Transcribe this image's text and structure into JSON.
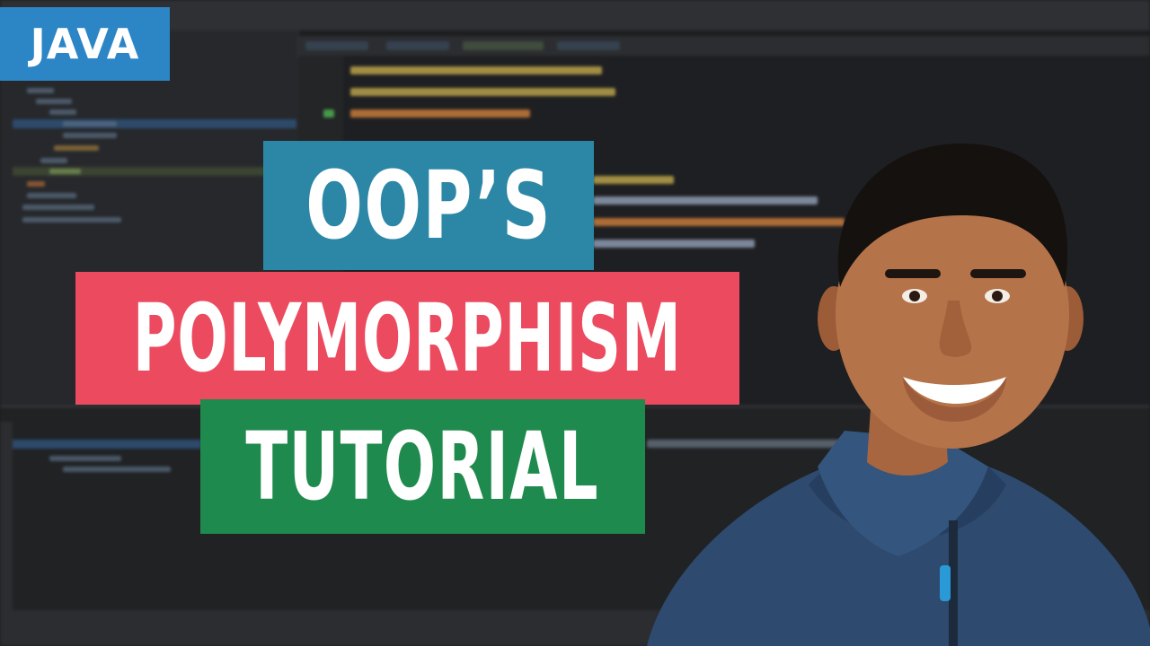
{
  "tag": {
    "label": "JAVA",
    "color": "#2c86c6"
  },
  "title": {
    "line1": "OOP’S",
    "line2": "POLYMORPHISM",
    "line3": "TUTORIAL"
  },
  "colors": {
    "line1_bg": "#2b87a5",
    "line2_bg": "#ec4a5f",
    "line3_bg": "#1f8a4d",
    "ide_bg": "#1e1f22"
  },
  "background": {
    "icon": "ide-code-editor"
  },
  "presenter": {
    "icon": "smiling-presenter-photo"
  }
}
